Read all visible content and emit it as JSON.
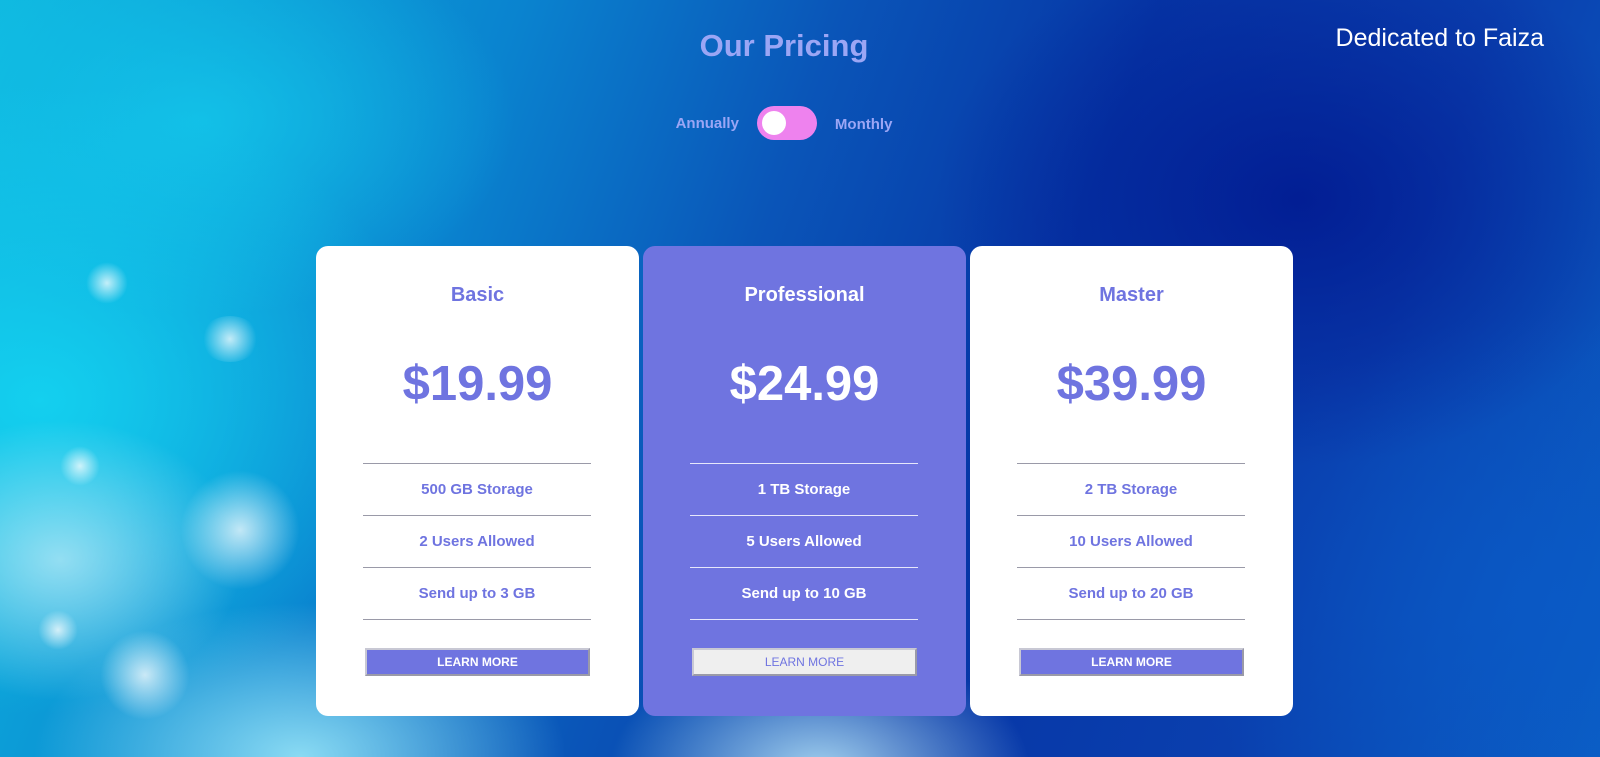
{
  "header": {
    "title": "Our Pricing",
    "dedication": "Dedicated to Faiza"
  },
  "billing": {
    "annually_label": "Annually",
    "monthly_label": "Monthly",
    "selected": "Annually"
  },
  "colors": {
    "accent": "#6f74e0",
    "toggle": "#ee82ee",
    "title": "#9ba6f5"
  },
  "plans": [
    {
      "name": "Basic",
      "price": "$19.99",
      "features": [
        "500 GB Storage",
        "2 Users Allowed",
        "Send up to 3 GB"
      ],
      "button_label": "LEARN MORE"
    },
    {
      "name": "Professional",
      "price": "$24.99",
      "features": [
        "1 TB Storage",
        "5 Users Allowed",
        "Send up to 10 GB"
      ],
      "button_label": "LEARN MORE"
    },
    {
      "name": "Master",
      "price": "$39.99",
      "features": [
        "2 TB Storage",
        "10 Users Allowed",
        "Send up to 20 GB"
      ],
      "button_label": "LEARN MORE"
    }
  ]
}
